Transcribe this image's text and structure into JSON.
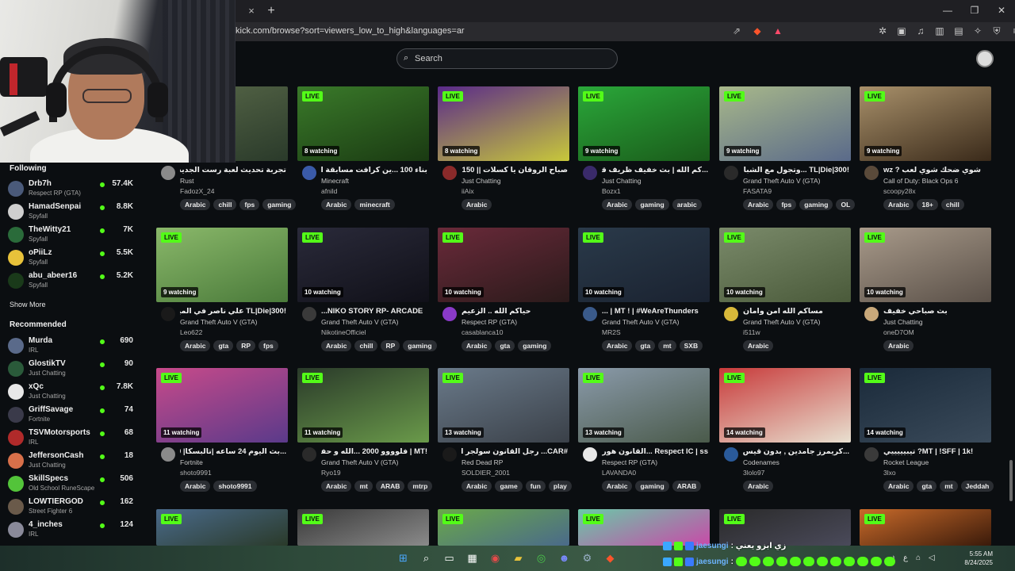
{
  "browser": {
    "url": "kick.com/browse?sort=viewers_low_to_high&languages=ar",
    "tab_close": "×",
    "tab_new": "+"
  },
  "header": {
    "search_placeholder": "Search"
  },
  "sidebar": {
    "following_label": "Following",
    "show_more_label": "Show More",
    "recommended_label": "Recommended",
    "following": [
      {
        "name": "Drb7h",
        "category": "Respect RP (GTA)",
        "viewers": "57.4K",
        "color": "#4a5a7a"
      },
      {
        "name": "HamadSenpai",
        "category": "Spyfall",
        "viewers": "8.8K",
        "color": "#cfcfcf"
      },
      {
        "name": "TheWitty21",
        "category": "Spyfall",
        "viewers": "7K",
        "color": "#2a6b3a"
      },
      {
        "name": "oPiiLz",
        "category": "Spyfall",
        "viewers": "5.5K",
        "color": "#e8c23a"
      },
      {
        "name": "abu_abeer16",
        "category": "Spyfall",
        "viewers": "5.2K",
        "color": "#1a3a1a"
      }
    ],
    "recommended": [
      {
        "name": "Murda",
        "category": "IRL",
        "viewers": "690",
        "color": "#5a6a8a"
      },
      {
        "name": "GlostikTV",
        "category": "Just Chatting",
        "viewers": "90",
        "color": "#2a5a3a"
      },
      {
        "name": "xQc",
        "category": "Just Chatting",
        "viewers": "7.8K",
        "color": "#e8e8e8"
      },
      {
        "name": "GriffSavage",
        "category": "Fortnite",
        "viewers": "74",
        "color": "#3a3a4a"
      },
      {
        "name": "TSVMotorsports",
        "category": "IRL",
        "viewers": "68",
        "color": "#b02a2a"
      },
      {
        "name": "JeffersonCash",
        "category": "Just Chatting",
        "viewers": "18",
        "color": "#d8704a"
      },
      {
        "name": "SkillSpecs",
        "category": "Old School RuneScape",
        "viewers": "506",
        "color": "#53c43a"
      },
      {
        "name": "LOWTIERGOD",
        "category": "Street Fighter 6",
        "viewers": "162",
        "color": "#6a5a4a"
      },
      {
        "name": "4_inches",
        "category": "IRL",
        "viewers": "124",
        "color": "#8a8a9a"
      }
    ]
  },
  "live_label": "LIVE",
  "streams": [
    {
      "title": "تجربة تحديث لعبة رست الجديد حياكم",
      "category": "Rust",
      "user": "FadozX_24",
      "watching": "",
      "tags": [
        "Arabic",
        "chill",
        "fps",
        "gaming"
      ],
      "bg": "#5a6a4a",
      "bg2": "#2a3a2a",
      "av": "#8a8a8a"
    },
    {
      "title": "بناء 100 ...ين كرافت مسابقة المتابعين 100",
      "category": "Minecraft",
      "user": "afnild",
      "watching": "8 watching",
      "tags": [
        "Arabic",
        "minecraft"
      ],
      "bg": "#3a7a2a",
      "bg2": "#1a3a12",
      "av": "#3a5aa8"
    },
    {
      "title": "صباح الروقان يا كسلات || 150?",
      "category": "Just Chatting",
      "user": "iiAix",
      "watching": "8 watching",
      "tags": [
        "Arabic"
      ],
      "bg": "#5a2a8a",
      "bg2": "#c8c83a",
      "av": "#8a2a2a"
    },
    {
      "title": "...كم الله | بث خفيف ظريف قبل الجامعة",
      "category": "Just Chatting",
      "user": "Bozx1",
      "watching": "9 watching",
      "tags": [
        "Arabic",
        "gaming",
        "arabic"
      ],
      "bg": "#2aa83a",
      "bg2": "#1a5a1a",
      "av": "#3a2a6a"
    },
    {
      "title": "!TL|Die|300 ...وتجول مع الشباب",
      "category": "Grand Theft Auto V (GTA)",
      "user": "FASATA9",
      "watching": "9 watching",
      "tags": [
        "Arabic",
        "fps",
        "gaming",
        "OL"
      ],
      "bg": "#a8b88a",
      "bg2": "#5a6a8a",
      "av": "#2a2a2a"
    },
    {
      "title": "شوي ضحك شوي لعب ? wz",
      "category": "Call of Duty: Black Ops 6",
      "user": "scoopy28x",
      "watching": "9 watching",
      "tags": [
        "Arabic",
        "18+",
        "chill"
      ],
      "bg": "#a8906a",
      "bg2": "#3a2a1a",
      "av": "#5a4a3a"
    },
    {
      "title": "!TL|Die|300 علي ناصر في الميدان",
      "category": "Grand Theft Auto V (GTA)",
      "user": "Leo622",
      "watching": "9 watching",
      "tags": [
        "Arabic",
        "gta",
        "RP",
        "fps"
      ],
      "bg": "#8ab86a",
      "bg2": "#4a7a3a",
      "av": "#1a1a1a"
    },
    {
      "title": "NIKO STORY RP- ARCADE...",
      "category": "Grand Theft Auto V (GTA)",
      "user": "NikotineOfficiel",
      "watching": "10 watching",
      "tags": [
        "Arabic",
        "chill",
        "RP",
        "gaming"
      ],
      "bg": "#2a2a3a",
      "bg2": "#101018",
      "av": "#3a3a3a"
    },
    {
      "title": "حياكم الله .. الزعيم",
      "category": "Respect RP (GTA)",
      "user": "casablanca10",
      "watching": "10 watching",
      "tags": [
        "Arabic",
        "gta",
        "gaming"
      ],
      "bg": "#6a2a3a",
      "bg2": "#2a1a1a",
      "av": "#8a3ac8"
    },
    {
      "title": "MT ! | #WeAreThunders | ...",
      "category": "Grand Theft Auto V (GTA)",
      "user": "MR2S",
      "watching": "10 watching",
      "tags": [
        "Arabic",
        "gta",
        "mt",
        "SXB"
      ],
      "bg": "#2a3a4a",
      "bg2": "#1a2230",
      "av": "#3a5a8a"
    },
    {
      "title": "مساكم الله امن وامان",
      "category": "Grand Theft Auto V (GTA)",
      "user": "i511w",
      "watching": "10 watching",
      "tags": [
        "Arabic"
      ],
      "bg": "#7a8a6a",
      "bg2": "#4a5a3a",
      "av": "#d8b83a"
    },
    {
      "title": "بث صباحي خفيف",
      "category": "Just Chatting",
      "user": "oneD7OM",
      "watching": "10 watching",
      "tags": [
        "Arabic"
      ],
      "bg": "#a89a8a",
      "bg2": "#5a5048",
      "av": "#c8a87a"
    },
    {
      "title": "...بث اليوم 24 ساعه |تالبسكا| 300!",
      "category": "Fortnite",
      "user": "shoto9991",
      "watching": "11 watching",
      "tags": [
        "Arabic",
        "shoto9991"
      ],
      "bg": "#c84a8a",
      "bg2": "#5a3a8a",
      "av": "#8a8a8a"
    },
    {
      "title": "!MT | فلوووو 2000 ...الله و حفظنا",
      "category": "Grand Theft Auto V (GTA)",
      "user": "Ryo19",
      "watching": "11 watching",
      "tags": [
        "Arabic",
        "mt",
        "ARAB",
        "mtrp"
      ],
      "bg": "#2a3a2a",
      "bg2": "#6a9a4a",
      "av": "#2a2a2a"
    },
    {
      "title": "#CAR... رجل القانون سولجر ال بارو",
      "category": "Red Dead RP",
      "user": "SOLDIER_2001",
      "watching": "13 watching",
      "tags": [
        "Arabic",
        "game",
        "fun",
        "play"
      ],
      "bg": "#6a7a8a",
      "bg2": "#3a4048",
      "av": "#1a1a1a"
    },
    {
      "title": "Respect IC | ss ...القانون هورررر",
      "category": "Respect RP (GTA)",
      "user": "LAVANDA0",
      "watching": "13 watching",
      "tags": [
        "Arabic",
        "gaming",
        "ARAB"
      ],
      "bg": "#8a9aaa",
      "bg2": "#4a5a4a",
      "av": "#e8e8e8"
    },
    {
      "title": "...كريمرز جامدين , بدون قيس كام متوكا",
      "category": "Codenames",
      "user": "3lolo97",
      "watching": "14 watching",
      "tags": [
        "Arabic"
      ],
      "bg": "#c83a3a",
      "bg2": "#e8e0d0",
      "av": "#2a5a9a"
    },
    {
      "title": "!MT | !SFF | 1k? تيبيييييي",
      "category": "Rocket League",
      "user": "3lxo",
      "watching": "14 watching",
      "tags": [
        "Arabic",
        "gta",
        "mt",
        "Jeddah"
      ],
      "bg": "#1a2a3a",
      "bg2": "#3a4a5a",
      "av": "#3a3a3a"
    }
  ],
  "partials": [
    {
      "bg": "#4a6a8a",
      "bg2": "#2a3a2a"
    },
    {
      "bg": "#3a3a3a",
      "bg2": "#8a8a8a"
    },
    {
      "bg": "#6aa84a",
      "bg2": "#4a6a8a"
    },
    {
      "bg": "#6ac8a8",
      "bg2": "#c84aa8"
    },
    {
      "bg": "#2a2a2a",
      "bg2": "#4a4a5a"
    },
    {
      "bg": "#c86a2a",
      "bg2": "#3a1a0a"
    }
  ],
  "chat": [
    {
      "user": "jaesungi",
      "msg": ": زي ابزو يعني",
      "emotes": 0
    },
    {
      "user": "jaesungi",
      "msg": ":",
      "emotes": 12
    }
  ],
  "clock": {
    "time": "5:55 AM",
    "date": "8/24/2025"
  },
  "tray": {
    "lang": "ع"
  },
  "colors": {
    "accent": "#53fc18",
    "bg": "#0b0e11",
    "tag_bg": "#2b2e33"
  }
}
